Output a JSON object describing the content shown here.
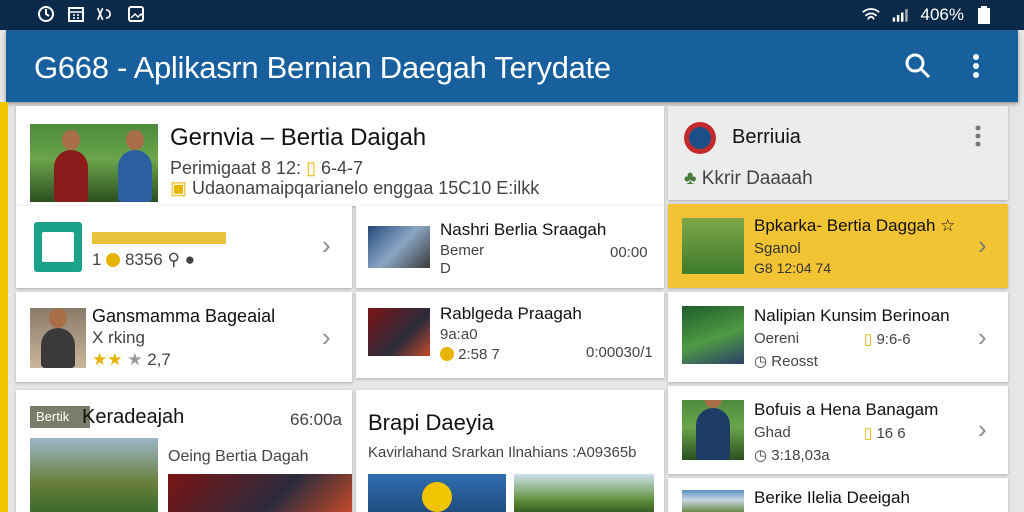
{
  "status": {
    "battery": "406%"
  },
  "appbar": {
    "title": "G668 - Aplikasrn Bernian Daegah Terydate"
  },
  "featured": {
    "title": "Gernvia – Bertia Daigah",
    "meta1": "Perimigaat 8 12:",
    "meta1b": "6-4-7",
    "meta2": "Udaonamaipqarianelo enggaa 15C10 E:ilkk"
  },
  "left_items": [
    {
      "title": "",
      "meta": "1",
      "meta2": "8356",
      "badge": ""
    },
    {
      "title": "Gansmamma Bageaial",
      "meta": "X rking",
      "rating": "2,7"
    }
  ],
  "mid_items": [
    {
      "title": "Nashri Berlia Sraagah",
      "meta": "Bemer",
      "meta2": "D",
      "time": "00:00"
    },
    {
      "title": "Rablgeda Praagah",
      "meta": "9a:a0",
      "meta2": "2:58 7",
      "time": "0:00030/1"
    }
  ],
  "bottom_left": {
    "badge": "Bertik",
    "title": "Keradeajah",
    "value": "66:00a",
    "sub": "Oeing Bertia Dagah"
  },
  "bottom_mid": {
    "title": "Brapi Daeyia",
    "sub": "Kavirlahand Srarkan Ilnahians :A09365b"
  },
  "right_header": {
    "title": "Berriuia",
    "sub": "Kkrir Daaaah"
  },
  "right_items": [
    {
      "title": "Bpkarka- Bertia Daggah",
      "meta": "Sganol",
      "meta2": "G8 12:04 74",
      "highlight": true
    },
    {
      "title": "Nalipian Kunsim Berinoan",
      "meta": "Oereni",
      "meta2": "9:6-6",
      "meta3": "Reosst"
    },
    {
      "title": "Bofuis a Hena Banagam",
      "meta": "Ghad",
      "meta2": "16 6",
      "meta3": "3:18,03a"
    },
    {
      "title": "Berike Ilelia Deeigah"
    }
  ]
}
